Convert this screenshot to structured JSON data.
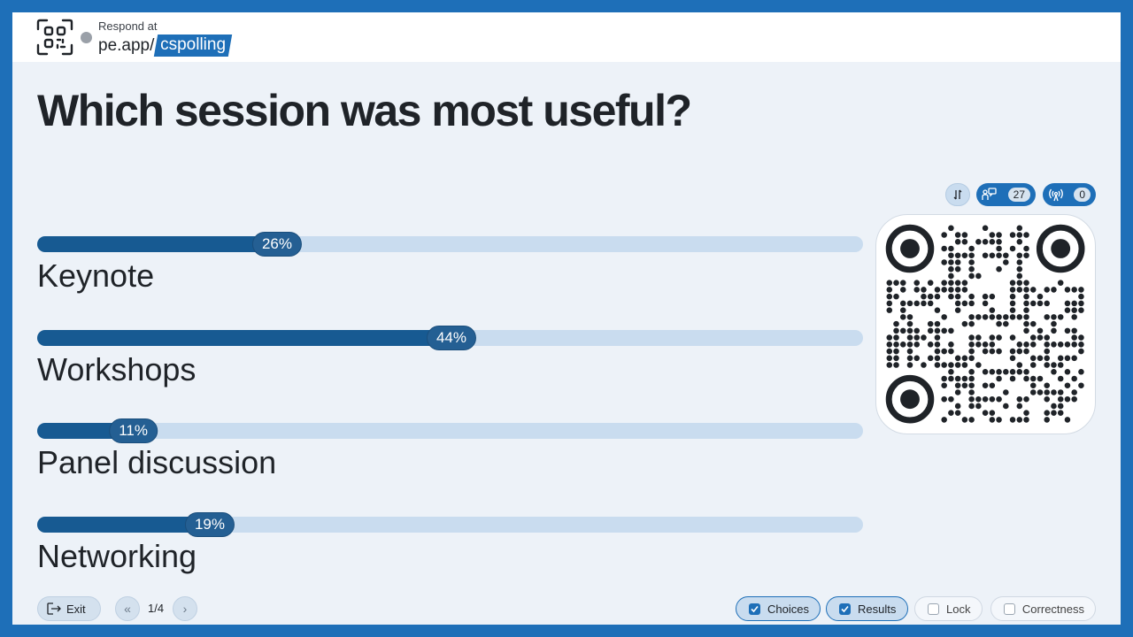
{
  "header": {
    "respond_label": "Respond at",
    "url_prefix": "pe.app/",
    "url_code": "cspolling"
  },
  "question": {
    "title": "Which session was most useful?"
  },
  "stats": {
    "responses": "27",
    "live": "0"
  },
  "results": [
    {
      "label": "Keynote",
      "percent_text": "26%",
      "fraction": 0.26
    },
    {
      "label": "Workshops",
      "percent_text": "44%",
      "fraction": 0.44
    },
    {
      "label": "Panel discussion",
      "percent_text": "11%",
      "fraction": 0.11
    },
    {
      "label": "Networking",
      "percent_text": "19%",
      "fraction": 0.19
    }
  ],
  "footer": {
    "exit_label": "Exit",
    "page_indicator": "1/4",
    "toggles": [
      {
        "label": "Choices",
        "checked": true
      },
      {
        "label": "Results",
        "checked": true
      },
      {
        "label": "Lock",
        "checked": false
      },
      {
        "label": "Correctness",
        "checked": false
      }
    ]
  },
  "icons": {
    "logo": "qr-frame-icon",
    "sort": "sort-arrows-icon",
    "responses": "people-chat-icon",
    "live": "broadcast-icon",
    "exit": "exit-icon",
    "prev": "double-chevron-left-icon",
    "next": "chevron-right-icon"
  },
  "colors": {
    "accent": "#1e6fb8",
    "bar_fill": "#175a92",
    "bar_track": "#c9dcef"
  }
}
